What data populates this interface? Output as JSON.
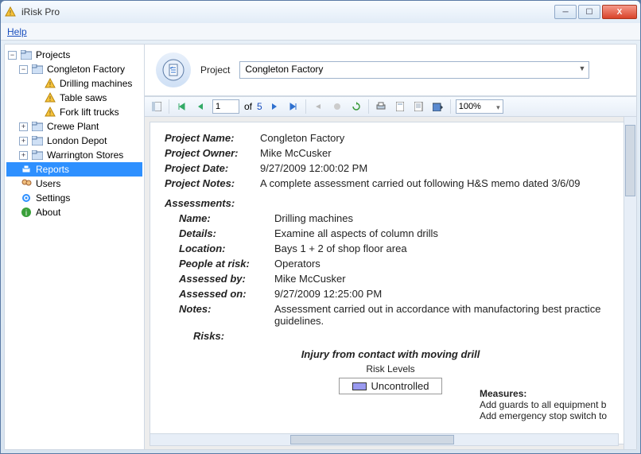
{
  "window": {
    "title": "iRisk Pro"
  },
  "menubar": {
    "help": "Help"
  },
  "tree": {
    "root": "Projects",
    "congleton": "Congleton Factory",
    "drilling": "Drilling machines",
    "tablesaws": "Table saws",
    "forklift": "Fork lift trucks",
    "crewe": "Crewe Plant",
    "london": "London Depot",
    "warrington": "Warrington Stores",
    "reports": "Reports",
    "users": "Users",
    "settings": "Settings",
    "about": "About"
  },
  "project_selector": {
    "label": "Project",
    "value": "Congleton Factory"
  },
  "toolbar": {
    "page_current": "1",
    "page_of": "of",
    "page_total": "5",
    "zoom": "100%"
  },
  "report": {
    "labels": {
      "project_name": "Project Name:",
      "project_owner": "Project Owner:",
      "project_date": "Project Date:",
      "project_notes": "Project Notes:",
      "assessments": "Assessments:",
      "name": "Name:",
      "details": "Details:",
      "location": "Location:",
      "people_at_risk": "People at risk:",
      "assessed_by": "Assessed by:",
      "assessed_on": "Assessed on:",
      "notes": "Notes:",
      "risks": "Risks:",
      "risk_levels": "Risk Levels",
      "measures": "Measures:",
      "uncontrolled": "Uncontrolled"
    },
    "values": {
      "project_name": "Congleton Factory",
      "project_owner": "Mike McCusker",
      "project_date": "9/27/2009 12:00:02 PM",
      "project_notes": "A complete assessment carried out following H&S memo dated 3/6/09",
      "name": "Drilling machines",
      "details": "Examine all aspects of column drills",
      "location": "Bays 1 + 2 of shop floor area",
      "people_at_risk": "Operators",
      "assessed_by": "Mike McCusker",
      "assessed_on": "9/27/2009 12:25:00 PM",
      "notes": "Assessment carried out in accordance with manufactoring best practice guidelines.",
      "risk_title": "Injury from contact with moving drill",
      "measures_text": "Add guards to all equipment b\nAdd emergency stop switch to"
    }
  },
  "icons": {
    "warning": "⚠",
    "folder": "folder",
    "printer": "printer",
    "users": "users",
    "gear": "gear",
    "info": "info"
  }
}
